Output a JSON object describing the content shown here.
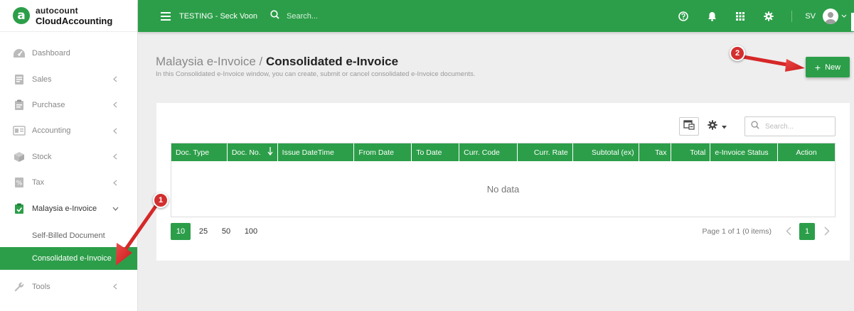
{
  "brand": {
    "logo_letter": "a",
    "top": "autocount",
    "bottom": "CloudAccounting"
  },
  "sidebar": {
    "items": [
      {
        "label": "Dashboard",
        "icon": "dashboard-icon",
        "chevron": ""
      },
      {
        "label": "Sales",
        "icon": "sales-icon",
        "chevron": "left"
      },
      {
        "label": "Purchase",
        "icon": "purchase-icon",
        "chevron": "left"
      },
      {
        "label": "Accounting",
        "icon": "accounting-icon",
        "chevron": "left"
      },
      {
        "label": "Stock",
        "icon": "stock-icon",
        "chevron": "left"
      },
      {
        "label": "Tax",
        "icon": "tax-icon",
        "chevron": "left"
      },
      {
        "label": "Malaysia e-Invoice",
        "icon": "einvoice-icon",
        "chevron": "down"
      }
    ],
    "subitems": [
      {
        "label": "Self-Billed Document",
        "active": false
      },
      {
        "label": "Consolidated e-Invoice",
        "active": true
      }
    ],
    "tools": {
      "label": "Tools",
      "icon": "wrench-icon"
    }
  },
  "topbar": {
    "company": "TESTING - Seck Voon",
    "search_placeholder": "Search...",
    "user_initials": "SV"
  },
  "page": {
    "breadcrumb_parent": "Malaysia e-Invoice",
    "separator": "/",
    "title": "Consolidated e-Invoice",
    "description": "In this Consolidated e-Invoice window, you can create, submit or cancel consolidated e-Invoice documents.",
    "new_button": "New"
  },
  "grid": {
    "search_placeholder": "Search...",
    "columns": [
      "Doc. Type",
      "Doc. No.",
      "Issue DateTime",
      "From Date",
      "To Date",
      "Curr. Code",
      "Curr. Rate",
      "Subtotal (ex)",
      "Tax",
      "Total",
      "e-Invoice Status",
      "Action"
    ],
    "empty_text": "No data"
  },
  "pager": {
    "sizes": [
      "10",
      "25",
      "50",
      "100"
    ],
    "active_size": "10",
    "info": "Page 1 of 1 (0 items)",
    "current_page": "1"
  },
  "annotations": {
    "badge1": "1",
    "badge2": "2"
  },
  "colors": {
    "primary": "#2c9e49",
    "annotation": "#d32f2f"
  }
}
